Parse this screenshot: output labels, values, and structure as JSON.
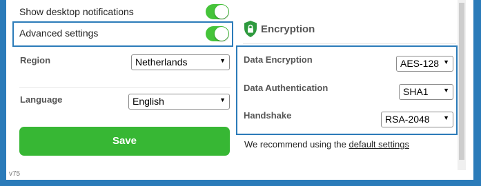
{
  "left": {
    "desktop_notifications": {
      "label": "Show desktop notifications",
      "enabled": true
    },
    "advanced_settings": {
      "label": "Advanced settings",
      "enabled": true
    },
    "region": {
      "label": "Region",
      "value": "Netherlands"
    },
    "language": {
      "label": "Language",
      "value": "English"
    },
    "save_label": "Save",
    "version": "v75"
  },
  "encryption": {
    "title": "Encryption",
    "data_encryption": {
      "label": "Data Encryption",
      "value": "AES-128"
    },
    "data_authentication": {
      "label": "Data Authentication",
      "value": "SHA1"
    },
    "handshake": {
      "label": "Handshake",
      "value": "RSA-2048"
    },
    "recommend_prefix": "We recommend using the",
    "recommend_link": "default settings"
  },
  "icons": {
    "shield": "shield-lock-icon",
    "dropdown": "chevron-down-icon"
  },
  "colors": {
    "accent_blue": "#2b7bb9",
    "toggle_green": "#45c43a",
    "save_green": "#37b734",
    "shield_green": "#2e9a3e"
  }
}
